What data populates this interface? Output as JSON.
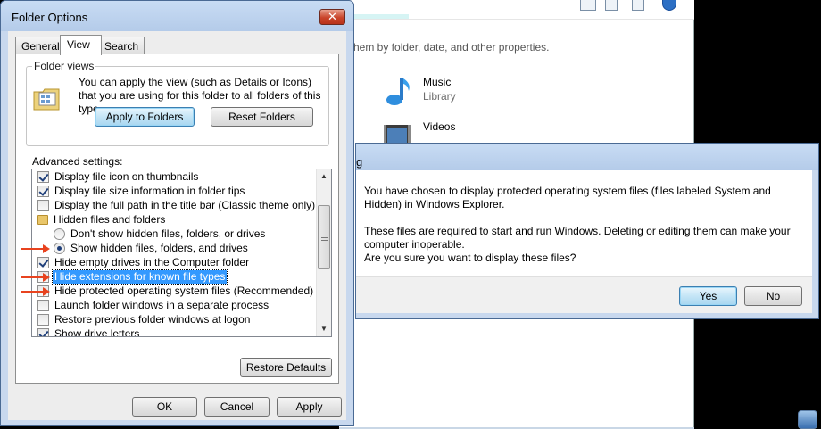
{
  "explorer": {
    "description": "hem by folder, date, and other properties.",
    "libraries": [
      {
        "name": "Music",
        "type": "Library"
      },
      {
        "name": "Videos",
        "type": ""
      }
    ]
  },
  "folder_options": {
    "title": "Folder Options",
    "close_label": "✕",
    "tabs": [
      {
        "label": "General"
      },
      {
        "label": "View"
      },
      {
        "label": "Search"
      }
    ],
    "active_tab": "View",
    "folder_views": {
      "legend": "Folder views",
      "text": "You can apply the view (such as Details or Icons) that you are using for this folder to all folders of this type.",
      "apply_label": "Apply to Folders",
      "reset_label": "Reset Folders"
    },
    "advanced_label": "Advanced settings:",
    "settings": [
      {
        "kind": "checkbox",
        "checked": true,
        "label": "Display file icon on thumbnails",
        "indent": 0
      },
      {
        "kind": "checkbox",
        "checked": true,
        "label": "Display file size information in folder tips",
        "indent": 0
      },
      {
        "kind": "checkbox",
        "checked": false,
        "label": "Display the full path in the title bar (Classic theme only)",
        "indent": 0
      },
      {
        "kind": "folder",
        "checked": false,
        "label": "Hidden files and folders",
        "indent": 0
      },
      {
        "kind": "radio",
        "checked": false,
        "label": "Don't show hidden files, folders, or drives",
        "indent": 1
      },
      {
        "kind": "radio",
        "checked": true,
        "label": "Show hidden files, folders, and drives",
        "indent": 1
      },
      {
        "kind": "checkbox",
        "checked": true,
        "label": "Hide empty drives in the Computer folder",
        "indent": 0
      },
      {
        "kind": "checkbox",
        "checked": false,
        "label": "Hide extensions for known file types",
        "indent": 0,
        "selected": true
      },
      {
        "kind": "checkbox",
        "checked": false,
        "label": "Hide protected operating system files (Recommended)",
        "indent": 0
      },
      {
        "kind": "checkbox",
        "checked": false,
        "label": "Launch folder windows in a separate process",
        "indent": 0
      },
      {
        "kind": "checkbox",
        "checked": false,
        "label": "Restore previous folder windows at logon",
        "indent": 0
      },
      {
        "kind": "checkbox",
        "checked": true,
        "label": "Show drive letters",
        "indent": 0
      }
    ],
    "restore_defaults_label": "Restore Defaults",
    "ok_label": "OK",
    "cancel_label": "Cancel",
    "apply_label": "Apply"
  },
  "confirm": {
    "title": "g",
    "message1": "You have chosen to display protected operating system files (files labeled System and Hidden) in Windows Explorer.",
    "message2": "These files are required to start and run Windows. Deleting or editing them can make your computer inoperable.",
    "message3": "Are you sure you want to display these files?",
    "yes_label": "Yes",
    "no_label": "No"
  },
  "colors": {
    "selection": "#3399ff",
    "annotation_arrow": "#e8431f"
  }
}
